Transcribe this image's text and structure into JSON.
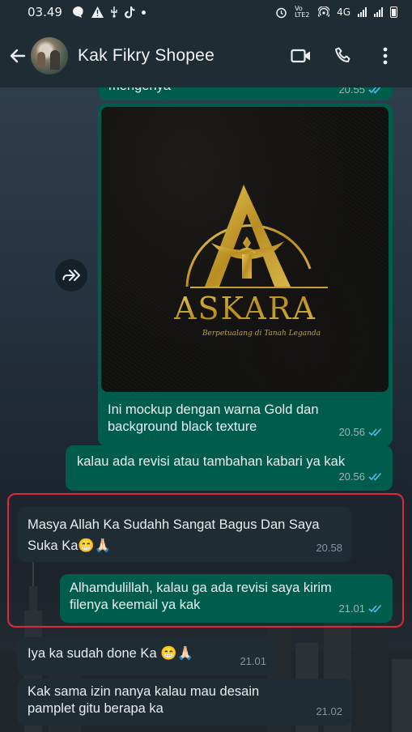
{
  "status_bar": {
    "time": "03.49",
    "network_label": "4G",
    "volte_label": "Vo LTE2"
  },
  "header": {
    "contact_name": "Kak Fikry Shopee"
  },
  "messages": [
    {
      "direction": "out",
      "text": "mengenya",
      "time": "20.55",
      "read": true
    },
    {
      "direction": "out",
      "type": "image",
      "caption": "Ini mockup dengan warna Gold dan background black texture",
      "time": "20.56",
      "read": true,
      "image": {
        "brand": "ASKARA",
        "tagline": "Berpetualang di Tanah Leganda",
        "logo_letter": "A"
      }
    },
    {
      "direction": "out",
      "text": "kalau ada revisi atau tambahan kabari ya kak",
      "time": "20.56",
      "read": true
    },
    {
      "direction": "in",
      "text": "Masya Allah Ka Sudahh Sangat Bagus Dan Saya Suka Ka😁🙏🏻",
      "time": "20.58"
    },
    {
      "direction": "out",
      "text": "Alhamdulillah, kalau ga ada revisi saya kirim filenya keemail ya kak",
      "time": "21.01",
      "read": true
    },
    {
      "direction": "in",
      "text": "Iya ka sudah done Ka 😁🙏🏻",
      "time": "21.01"
    },
    {
      "direction": "in",
      "text": "Kak sama izin nanya kalau mau desain pamplet gitu berapa ka",
      "time": "21.02"
    }
  ],
  "colors": {
    "outgoing_bubble": "#005c4b",
    "incoming_bubble": "#1f2c33",
    "read_ticks": "#53bdeb",
    "highlight_border": "#e0283a",
    "logo_gold": "#c9a227"
  },
  "icons": {
    "back": "arrow-left-icon",
    "video": "video-camera-icon",
    "call": "phone-icon",
    "menu": "more-vertical-icon",
    "forward": "forward-icon",
    "read": "double-check-icon"
  }
}
